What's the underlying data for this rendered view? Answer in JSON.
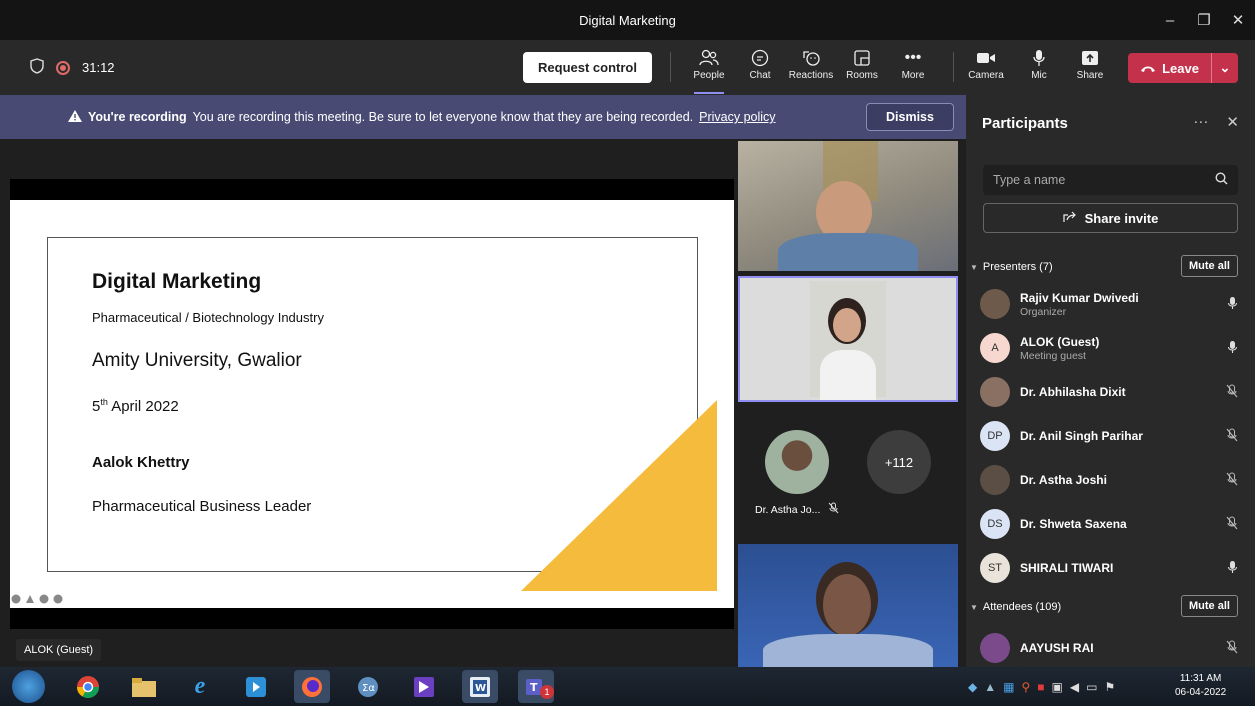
{
  "window": {
    "title": "Digital Marketing",
    "controls": [
      "–",
      "❐",
      "✕"
    ]
  },
  "toolbar": {
    "timer": "31:12",
    "request_control": "Request control",
    "buttons": [
      {
        "label": "People",
        "icon": "people-icon"
      },
      {
        "label": "Chat",
        "icon": "chat-icon"
      },
      {
        "label": "Reactions",
        "icon": "reactions-icon"
      },
      {
        "label": "Rooms",
        "icon": "rooms-icon"
      },
      {
        "label": "More",
        "icon": "more-icon"
      },
      {
        "label": "Camera",
        "icon": "camera-icon"
      },
      {
        "label": "Mic",
        "icon": "mic-icon"
      },
      {
        "label": "Share",
        "icon": "share-icon"
      }
    ],
    "leave": "Leave",
    "leave_color": "#c4314b",
    "accent": "#8e8ff0"
  },
  "banner": {
    "title": "You're recording",
    "message": "You are recording this meeting. Be sure to let everyone know that they are being recorded.",
    "link": "Privacy policy",
    "dismiss": "Dismiss"
  },
  "slide": {
    "title": "Digital Marketing",
    "subtitle": "Pharmaceutical / Biotechnology Industry",
    "university": "Amity University, Gwalior",
    "date_day": "5",
    "date_suffix": "th",
    "date_rest": " April 2022",
    "presenter": "Aalok Khettry",
    "role": "Pharmaceutical Business Leader",
    "accent": "#f5bb3c"
  },
  "stage": {
    "presenter_tag": "ALOK (Guest)",
    "overflow_count": "+112",
    "tile3_name": "Dr. Astha Jo..."
  },
  "panel": {
    "title": "Participants",
    "search_placeholder": "Type a name",
    "share_invite": "Share invite",
    "presenters_header": "Presenters (7)",
    "attendees_header": "Attendees (109)",
    "mute_all": "Mute all",
    "presenters": [
      {
        "initials": "",
        "name": "Rajiv Kumar Dwivedi",
        "role": "Organizer",
        "mic": "on",
        "color": "#6d5a4a"
      },
      {
        "initials": "A",
        "name": "ALOK (Guest)",
        "role": "Meeting guest",
        "mic": "on",
        "color": "#f6d8d0"
      },
      {
        "initials": "",
        "name": "Dr. Abhilasha Dixit",
        "role": "",
        "mic": "off",
        "color": "#8a6f63"
      },
      {
        "initials": "DP",
        "name": "Dr. Anil Singh Parihar",
        "role": "",
        "mic": "off",
        "color": "#dbe4f5"
      },
      {
        "initials": "",
        "name": "Dr. Astha Joshi",
        "role": "",
        "mic": "off",
        "color": "#5b4f45"
      },
      {
        "initials": "DS",
        "name": "Dr. Shweta Saxena",
        "role": "",
        "mic": "off",
        "color": "#dbe4f5"
      },
      {
        "initials": "ST",
        "name": "SHIRALI TIWARI",
        "role": "",
        "mic": "on",
        "color": "#e9e3da"
      }
    ],
    "attendees": [
      {
        "initials": "",
        "name": "AAYUSH RAI",
        "role": "",
        "mic": "off",
        "color": "#7a4a8a"
      }
    ]
  },
  "taskbar": {
    "time": "11:31 AM",
    "date": "06-04-2022",
    "teams_badge": "1"
  }
}
